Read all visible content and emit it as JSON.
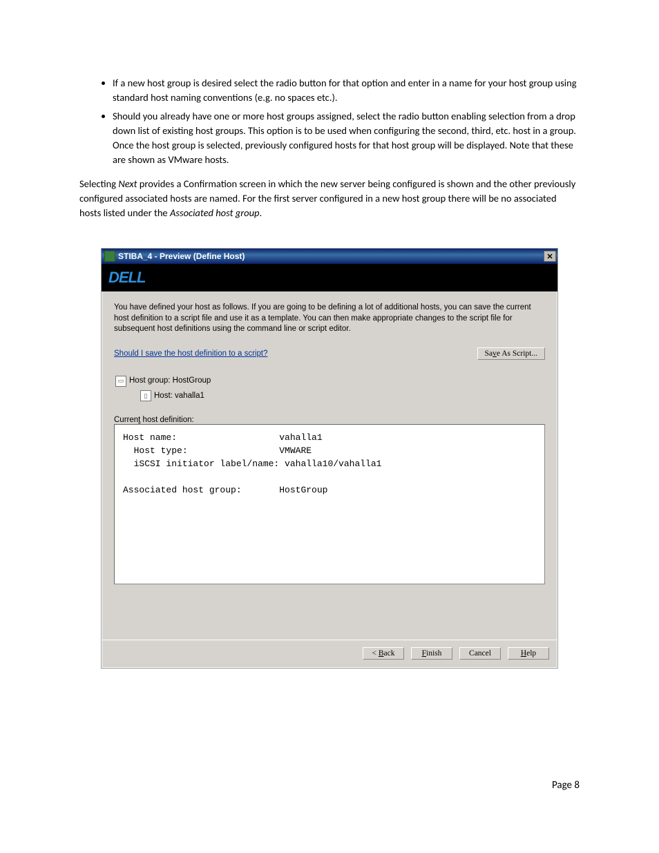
{
  "bullets": [
    "If a new host group is desired select the radio button for that option and enter in a name for your host group using standard host naming conventions (e.g. no spaces etc.).",
    "Should you already have one or more host groups assigned, select the radio button enabling selection from a drop down list of existing host groups. This option is to be used when configuring the second, third, etc. host in a group. Once the host group is selected, previously configured hosts for that host group will be displayed. Note that these are shown as VMware hosts."
  ],
  "para_pre": "Selecting ",
  "para_em": "Next",
  "para_mid": " provides a Confirmation screen in which the new server being configured is shown and the other previously configured associated hosts are named. For the first server configured in a new host group there will be no associated hosts listed under the ",
  "para_em2": "Associated host group",
  "para_post": ".",
  "window": {
    "title": "STIBA_4 - Preview (Define Host)",
    "brand": "DELL",
    "intro": "You have defined your host as follows.  If you are going to be defining a lot of additional hosts, you can save the current host definition to a script file and use it as a template. You can then make appropriate changes to the script file for subsequent host definitions using the command line or script editor.",
    "help_link": "Should I save the host definition to a script?",
    "save_script_btn": "Save As Script...",
    "tree_group_label": "Host group: HostGroup",
    "tree_host_label": "Host: vahalla1",
    "current_def_label": "Current host definition:",
    "def_text": "Host name:                   vahalla1\n  Host type:                 VMWARE\n  iSCSI initiator label/name: vahalla10/vahalla1\n\nAssociated host group:       HostGroup",
    "buttons": {
      "back": "< Back",
      "finish": "Finish",
      "cancel": "Cancel",
      "help": "Help"
    }
  },
  "footer": "Page 8"
}
